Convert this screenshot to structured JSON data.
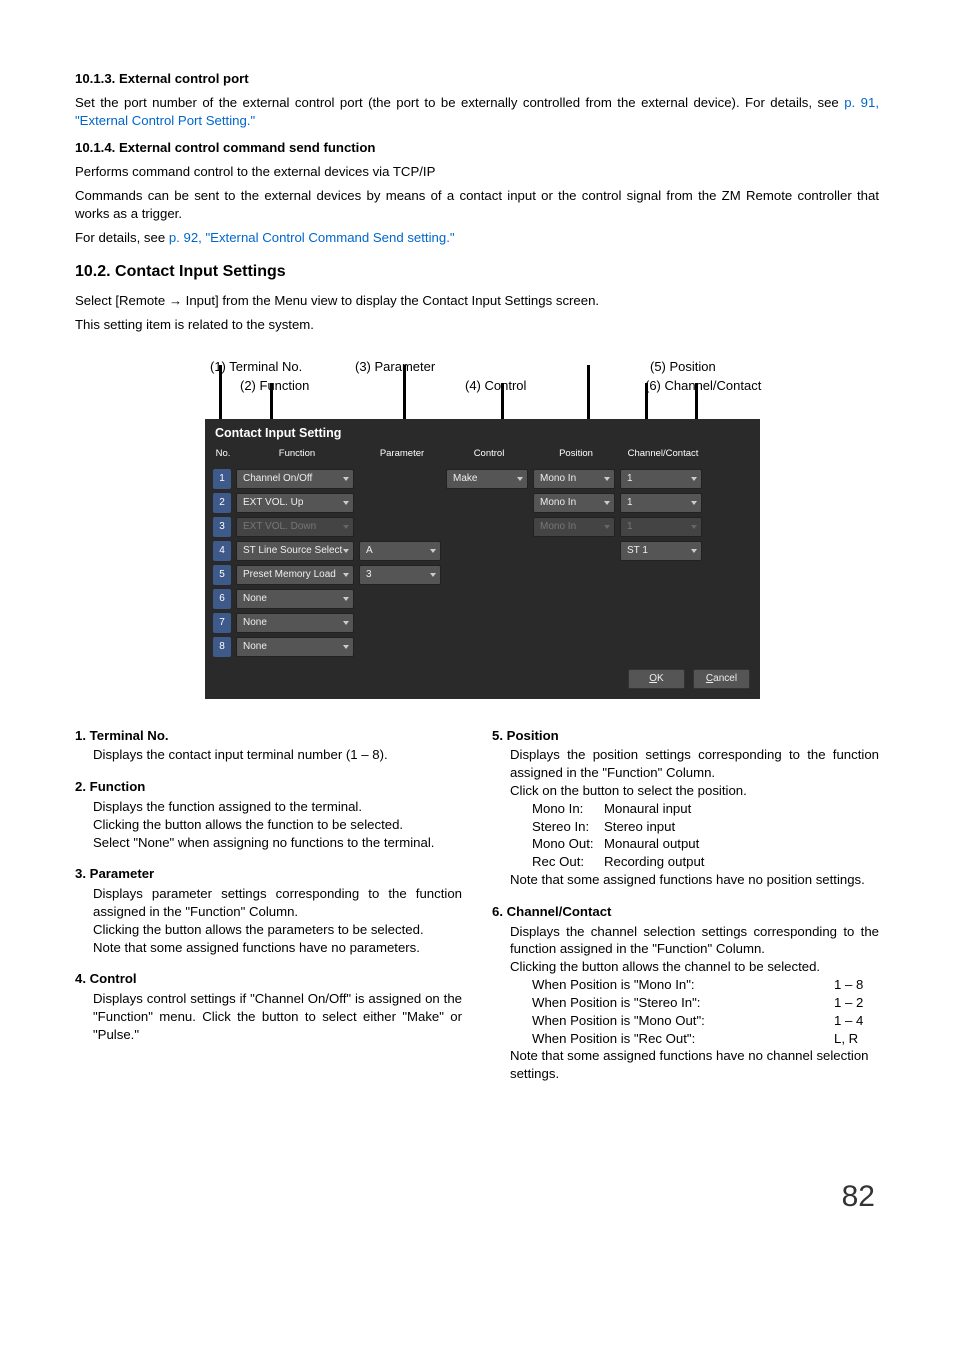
{
  "s1": {
    "h": "10.1.3. External control port",
    "p1a": "Set the port number of the external control port (the port to be externally controlled from the external device). For details, see ",
    "p1b": "p. 91, \"External Control Port Setting.\""
  },
  "s2": {
    "h": "10.1.4. External control command send function",
    "p1": "Performs command control to the external devices via TCP/IP",
    "p2": "Commands can be sent to the external devices by means of a contact input or the control signal from the ZM Remote controller that works as a trigger.",
    "p3a": "For details, see ",
    "p3b": "p. 92, \"External Control Command Send setting.\""
  },
  "s3": {
    "h": "10.2. Contact Input Settings",
    "p1": "Select [Remote → Input] from the Menu view to display the Contact Input Settings screen.",
    "p2": "This setting item is related to the system."
  },
  "captions": {
    "c1": "(1) Terminal No.",
    "c2": "(2) Function",
    "c3": "(3) Parameter",
    "c4": "(4) Control",
    "c5": "(5) Position",
    "c6": "(6) Channel/Contact"
  },
  "panel": {
    "title": "Contact Input Setting",
    "hdr": {
      "no": "No.",
      "func": "Function",
      "param": "Parameter",
      "ctrl": "Control",
      "pos": "Position",
      "chan": "Channel/Contact"
    },
    "rows": [
      {
        "n": "1",
        "func": "Channel On/Off",
        "param": null,
        "ctrl": "Make",
        "pos": "Mono In",
        "chan": "1"
      },
      {
        "n": "2",
        "func": "EXT VOL. Up",
        "param": null,
        "ctrl": null,
        "pos": "Mono In",
        "chan": "1"
      },
      {
        "n": "3",
        "func": "EXT VOL. Down",
        "disabled": true,
        "param": null,
        "ctrl": null,
        "pos": "Mono In",
        "pos_disabled": true,
        "chan": "1",
        "chan_disabled": true
      },
      {
        "n": "4",
        "func": "ST Line Source Select",
        "param": "A",
        "ctrl": null,
        "pos": null,
        "chan": "ST 1"
      },
      {
        "n": "5",
        "func": "Preset Memory Load",
        "param": "3",
        "ctrl": null,
        "pos": null,
        "chan": null
      },
      {
        "n": "6",
        "func": "None",
        "param": null,
        "ctrl": null,
        "pos": null,
        "chan": null
      },
      {
        "n": "7",
        "func": "None",
        "param": null,
        "ctrl": null,
        "pos": null,
        "chan": null
      },
      {
        "n": "8",
        "func": "None",
        "param": null,
        "ctrl": null,
        "pos": null,
        "chan": null
      }
    ],
    "ok": "OK",
    "cancel": "Cancel"
  },
  "desc": {
    "i1": {
      "h": "1. Terminal No.",
      "b": "Displays the contact input terminal number (1 – 8)."
    },
    "i2": {
      "h": "2. Function",
      "b1": "Displays the function assigned to the terminal.",
      "b2": "Clicking the button allows the function to be selected.",
      "b3": "Select \"None\" when assigning no functions to the terminal."
    },
    "i3": {
      "h": "3. Parameter",
      "b1": "Displays parameter settings corresponding to the function assigned in the \"Function\" Column.",
      "b2": "Clicking the button allows the parameters to be selected.",
      "b3": "Note that some assigned functions have no parameters."
    },
    "i4": {
      "h": "4. Control",
      "b": "Displays control settings if \"Channel On/Off\" is assigned on the \"Function\" menu. Click the button to select either \"Make\" or \"Pulse.\""
    },
    "i5": {
      "h": "5. Position",
      "b1": "Displays the position settings corresponding to the function assigned in the  \"Function\" Column.",
      "b2": "Click on the button to select the position.",
      "kv": [
        {
          "k": "Mono In:",
          "v": "Monaural input"
        },
        {
          "k": "Stereo In:",
          "v": "Stereo input"
        },
        {
          "k": "Mono Out:",
          "v": "Monaural output"
        },
        {
          "k": "Rec Out:",
          "v": "Recording output"
        }
      ],
      "b3": "Note that some assigned functions have no position settings."
    },
    "i6": {
      "h": "6. Channel/Contact",
      "b1": "Displays the channel selection settings corresponding to the function assigned in the \"Function\" Column.",
      "b2": "Clicking the button allows the channel to be selected.",
      "ranges": [
        {
          "l": "When Position is \"Mono In\":",
          "v": "1 – 8"
        },
        {
          "l": "When Position is \"Stereo In\":",
          "v": "1 – 2"
        },
        {
          "l": "When Position is \"Mono Out\":",
          "v": "1 – 4"
        },
        {
          "l": "When Position is \"Rec Out\":",
          "v": "L, R"
        }
      ],
      "b3": "Note that some assigned functions have no channel selection settings."
    }
  },
  "page": "82"
}
